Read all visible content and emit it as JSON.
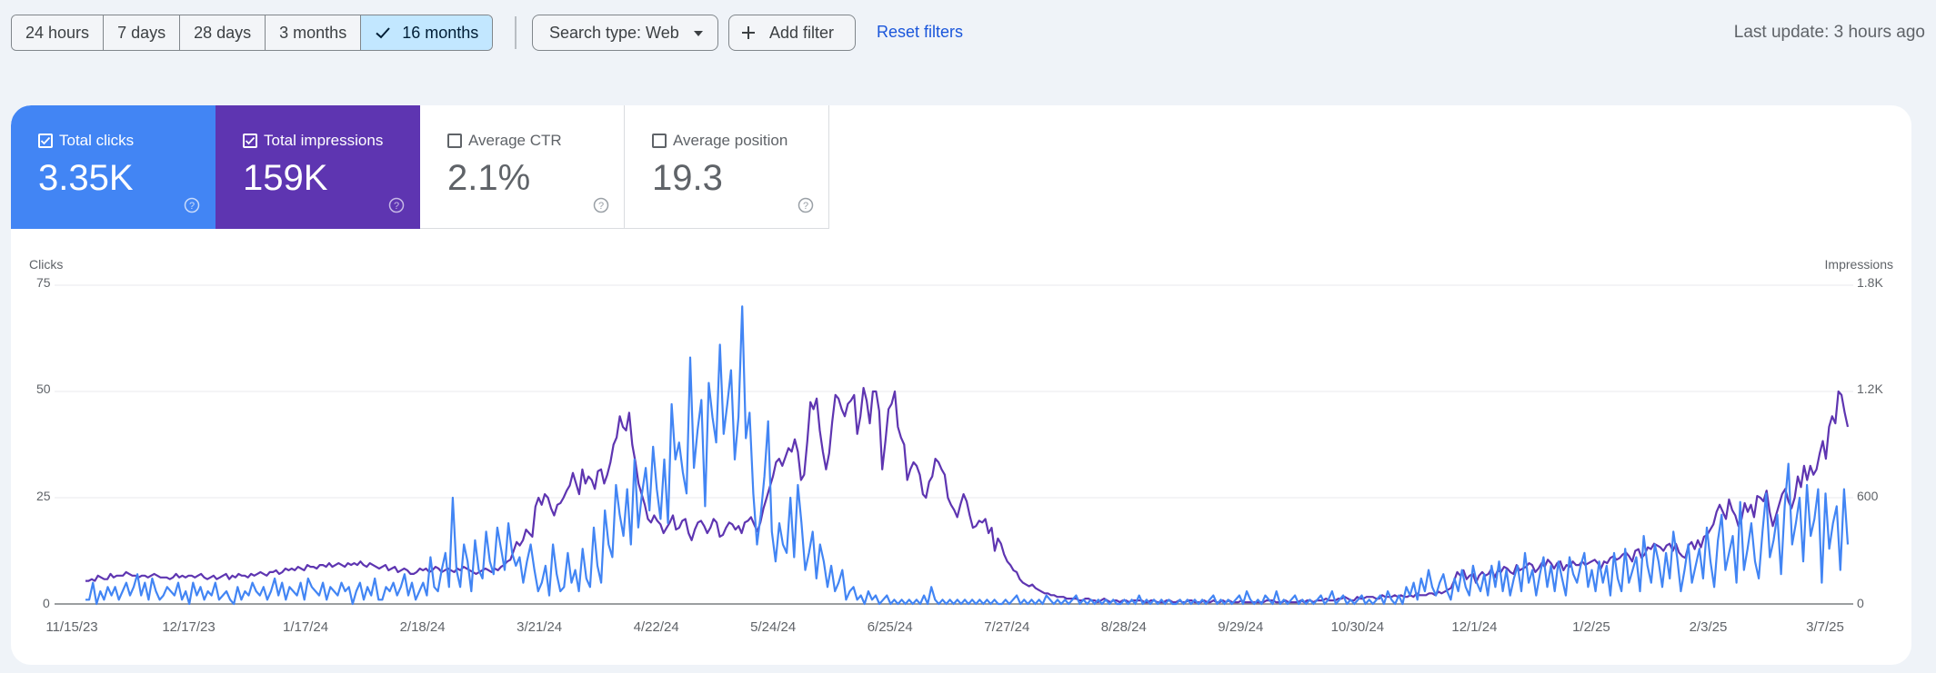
{
  "toolbar": {
    "ranges": [
      {
        "label": "24 hours",
        "active": false
      },
      {
        "label": "7 days",
        "active": false
      },
      {
        "label": "28 days",
        "active": false
      },
      {
        "label": "3 months",
        "active": false
      },
      {
        "label": "16 months",
        "active": true
      }
    ],
    "search_type_label": "Search type: Web",
    "add_filter_label": "Add filter",
    "reset_filters_label": "Reset filters",
    "last_update": "Last update: 3 hours ago"
  },
  "metrics": [
    {
      "label": "Total clicks",
      "value": "3.35K",
      "checked": true,
      "color": "#4285f4"
    },
    {
      "label": "Total impressions",
      "value": "159K",
      "checked": true,
      "color": "#5e35b1"
    },
    {
      "label": "Average CTR",
      "value": "2.1%",
      "checked": false,
      "color": "#ffffff"
    },
    {
      "label": "Average position",
      "value": "19.3",
      "checked": false,
      "color": "#ffffff"
    }
  ],
  "chart_data": {
    "type": "line",
    "left_axis_title": "Clicks",
    "right_axis_title": "Impressions",
    "left_ticks": [
      "75",
      "50",
      "25",
      "0"
    ],
    "right_ticks": [
      "1.8K",
      "1.2K",
      "600",
      "0"
    ],
    "left_ylim": [
      0,
      75
    ],
    "right_ylim": [
      0,
      1800
    ],
    "x_ticks": [
      "11/15/23",
      "12/17/23",
      "1/17/24",
      "2/18/24",
      "3/21/24",
      "4/22/24",
      "5/24/24",
      "6/25/24",
      "7/27/24",
      "8/28/24",
      "9/29/24",
      "10/30/24",
      "12/1/24",
      "1/2/25",
      "2/3/25",
      "3/7/25"
    ],
    "grid": true,
    "series": [
      {
        "name": "Total clicks",
        "axis": "left",
        "color": "#4285f4",
        "values": [
          1,
          1,
          5,
          0,
          3,
          1,
          4,
          2,
          4,
          1,
          3,
          5,
          2,
          4,
          7,
          2,
          5,
          1,
          6,
          3,
          1,
          2,
          4,
          3,
          2,
          5,
          1,
          3,
          0,
          5,
          2,
          4,
          1,
          3,
          2,
          5,
          1,
          2,
          3,
          1,
          0,
          4,
          1,
          3,
          2,
          5,
          3,
          2,
          4,
          1,
          3,
          6,
          2,
          5,
          1,
          4,
          3,
          2,
          5,
          1,
          6,
          4,
          3,
          2,
          5,
          1,
          4,
          3,
          2,
          5,
          3,
          4,
          0,
          3,
          5,
          1,
          4,
          2,
          6,
          1,
          1,
          4,
          3,
          5,
          2,
          4,
          7,
          2,
          5,
          1,
          3,
          5,
          2,
          11,
          4,
          3,
          8,
          12,
          4,
          25,
          8,
          4,
          14,
          10,
          3,
          15,
          8,
          6,
          17,
          10,
          7,
          18,
          13,
          8,
          19,
          12,
          9,
          11,
          5,
          10,
          14,
          8,
          3,
          5,
          9,
          2,
          14,
          7,
          3,
          4,
          12,
          5,
          8,
          3,
          13,
          6,
          4,
          18,
          9,
          5,
          22,
          14,
          11,
          28,
          21,
          16,
          27,
          14,
          34,
          18,
          26,
          32,
          22,
          37,
          27,
          20,
          34,
          19,
          47,
          34,
          38,
          31,
          26,
          58,
          32,
          41,
          48,
          23,
          52,
          44,
          38,
          61,
          40,
          47,
          55,
          34,
          44,
          70,
          39,
          45,
          26,
          14,
          21,
          30,
          43,
          17,
          10,
          19,
          14,
          12,
          25,
          11,
          28,
          19,
          8,
          12,
          17,
          6,
          14,
          10,
          4,
          9,
          3,
          5,
          8,
          1,
          3,
          4,
          1,
          2,
          0,
          3,
          1,
          2,
          0,
          1,
          2,
          0,
          1,
          0,
          1,
          0,
          1,
          0,
          1,
          0,
          2,
          0,
          4,
          1,
          0,
          1,
          0,
          1,
          0,
          1,
          0,
          1,
          0,
          1,
          0,
          1,
          0,
          1,
          0,
          1,
          0,
          0,
          1,
          0,
          1,
          2,
          0,
          1,
          0,
          1,
          0,
          1,
          0,
          2,
          1,
          0,
          1,
          0,
          1,
          0,
          1,
          2,
          0,
          1,
          0,
          1,
          0,
          1,
          0,
          1,
          0,
          1,
          0,
          0,
          1,
          0,
          1,
          0,
          2,
          0,
          1,
          0,
          1,
          0,
          1,
          0,
          1,
          0,
          0,
          1,
          0,
          1,
          0,
          1,
          0,
          1,
          0,
          1,
          2,
          0,
          1,
          0,
          1,
          0,
          1,
          2,
          0,
          3,
          1,
          0,
          1,
          0,
          2,
          1,
          0,
          3,
          0,
          1,
          0,
          1,
          2,
          0,
          1,
          0,
          1,
          0,
          1,
          2,
          0,
          1,
          3,
          0,
          1,
          2,
          0,
          1,
          0,
          1,
          2,
          0,
          1,
          0,
          1,
          2,
          0,
          3,
          1,
          0,
          2,
          0,
          4,
          2,
          5,
          1,
          6,
          3,
          8,
          4,
          2,
          5,
          7,
          3,
          1,
          6,
          3,
          8,
          4,
          2,
          9,
          5,
          3,
          7,
          2,
          9,
          4,
          10,
          3,
          8,
          2,
          6,
          9,
          3,
          12,
          5,
          8,
          2,
          7,
          11,
          4,
          9,
          3,
          10,
          6,
          2,
          11,
          7,
          5,
          9,
          12,
          4,
          8,
          3,
          10,
          5,
          9,
          2,
          12,
          6,
          3,
          13,
          5,
          8,
          11,
          3,
          16,
          9,
          5,
          14,
          10,
          4,
          12,
          6,
          17,
          11,
          3,
          8,
          14,
          5,
          9,
          13,
          6,
          18,
          10,
          4,
          15,
          21,
          8,
          12,
          16,
          5,
          24,
          8,
          13,
          19,
          10,
          6,
          17,
          26,
          11,
          15,
          21,
          7,
          23,
          33,
          14,
          19,
          25,
          10,
          28,
          16,
          20,
          27,
          5,
          26,
          13,
          19,
          23,
          8,
          27,
          14
        ]
      },
      {
        "name": "Total impressions",
        "axis": "right",
        "color": "#5e35b1",
        "values": [
          130,
          130,
          140,
          130,
          160,
          150,
          140,
          140,
          170,
          150,
          160,
          160,
          160,
          180,
          170,
          160,
          160,
          150,
          160,
          160,
          150,
          160,
          170,
          160,
          150,
          150,
          150,
          140,
          150,
          170,
          150,
          160,
          150,
          160,
          160,
          150,
          160,
          170,
          150,
          140,
          150,
          160,
          140,
          150,
          160,
          170,
          140,
          160,
          150,
          170,
          160,
          160,
          150,
          170,
          160,
          170,
          180,
          170,
          160,
          180,
          180,
          190,
          170,
          180,
          200,
          190,
          200,
          190,
          210,
          200,
          190,
          220,
          210,
          210,
          200,
          220,
          220,
          210,
          230,
          210,
          220,
          230,
          220,
          210,
          230,
          220,
          230,
          220,
          240,
          220,
          210,
          230,
          220,
          210,
          200,
          210,
          220,
          190,
          200,
          210,
          180,
          190,
          200,
          190,
          170,
          170,
          180,
          200,
          190,
          200,
          180,
          190,
          210,
          200,
          180,
          190,
          200,
          190,
          180,
          200,
          190,
          210,
          200,
          190,
          180,
          170,
          180,
          190,
          200,
          190,
          180,
          200,
          190,
          210,
          220,
          240,
          250,
          300,
          350,
          330,
          360,
          420,
          400,
          380,
          550,
          600,
          560,
          620,
          600,
          540,
          500,
          560,
          570,
          600,
          640,
          670,
          740,
          680,
          620,
          760,
          680,
          720,
          700,
          650,
          750,
          760,
          680,
          730,
          800,
          900,
          940,
          1060,
          1000,
          980,
          1080,
          900,
          800,
          680,
          620,
          560,
          480,
          460,
          500,
          470,
          450,
          400,
          430,
          460,
          500,
          420,
          430,
          470,
          480,
          400,
          360,
          420,
          460,
          470,
          440,
          400,
          430,
          480,
          460,
          380,
          390,
          430,
          460,
          450,
          420,
          440,
          400,
          460,
          470,
          490,
          450,
          410,
          460,
          540,
          600,
          660,
          720,
          800,
          820,
          780,
          830,
          880,
          860,
          930,
          860,
          700,
          730,
          920,
          1140,
          1100,
          1160,
          980,
          860,
          760,
          850,
          1030,
          1180,
          1160,
          1100,
          1060,
          1130,
          1150,
          1180,
          960,
          1060,
          1220,
          1150,
          1020,
          1200,
          1200,
          1090,
          760,
          920,
          1100,
          1130,
          1200,
          1000,
          940,
          900,
          700,
          760,
          800,
          780,
          730,
          620,
          600,
          690,
          720,
          820,
          800,
          760,
          730,
          600,
          560,
          530,
          490,
          560,
          620,
          580,
          500,
          430,
          440,
          470,
          460,
          480,
          400,
          430,
          300,
          370,
          340,
          280,
          240,
          220,
          190,
          180,
          140,
          120,
          110,
          100,
          110,
          90,
          80,
          70,
          60,
          60,
          50,
          50,
          40,
          40,
          40,
          30,
          30,
          30,
          30,
          20,
          20,
          30,
          30,
          20,
          20,
          10,
          20,
          30,
          20,
          10,
          20,
          20,
          10,
          20,
          20,
          10,
          20,
          20,
          20,
          20,
          10,
          10,
          20,
          20,
          10,
          10,
          10,
          20,
          20,
          10,
          10,
          20,
          10,
          10,
          20,
          20,
          10,
          10,
          10,
          20,
          10,
          10,
          20,
          10,
          10,
          20,
          10,
          20,
          10,
          10,
          10,
          20,
          10,
          10,
          10,
          10,
          10,
          10,
          10,
          20,
          20,
          20,
          10,
          10,
          10,
          20,
          10,
          10,
          10,
          10,
          20,
          10,
          20,
          20,
          10,
          20,
          20,
          20,
          30,
          20,
          20,
          20,
          30,
          30,
          40,
          30,
          20,
          20,
          40,
          30,
          30,
          40,
          40,
          40,
          30,
          30,
          50,
          40,
          40,
          40,
          50,
          40,
          50,
          40,
          40,
          50,
          40,
          60,
          50,
          50,
          50,
          60,
          60,
          50,
          70,
          60,
          70,
          80,
          90,
          130,
          180,
          160,
          190,
          140,
          160,
          170,
          120,
          160,
          180,
          160,
          170,
          200,
          150,
          190,
          180,
          210,
          200,
          180,
          170,
          220,
          190,
          200,
          210,
          230,
          220,
          180,
          200,
          230,
          210,
          250,
          230,
          200,
          230,
          240,
          190,
          220,
          210,
          240,
          220,
          220,
          240,
          220,
          230,
          240,
          250,
          230,
          200,
          240,
          230,
          260,
          270,
          250,
          260,
          280,
          290,
          270,
          240,
          300,
          310,
          260,
          280,
          320,
          310,
          340,
          330,
          320,
          300,
          330,
          340,
          300,
          340,
          290,
          270,
          260,
          330,
          350,
          310,
          360,
          320,
          380,
          390,
          420,
          450,
          520,
          560,
          520,
          480,
          590,
          530,
          500,
          440,
          480,
          570,
          520,
          560,
          490,
          610,
          600,
          580,
          640,
          520,
          440,
          500,
          560,
          620,
          650,
          580,
          540,
          600,
          720,
          660,
          780,
          700,
          780,
          730,
          760,
          850,
          920,
          820,
          1000,
          1060,
          1020,
          1200,
          1180,
          1080,
          1000
        ]
      }
    ]
  }
}
